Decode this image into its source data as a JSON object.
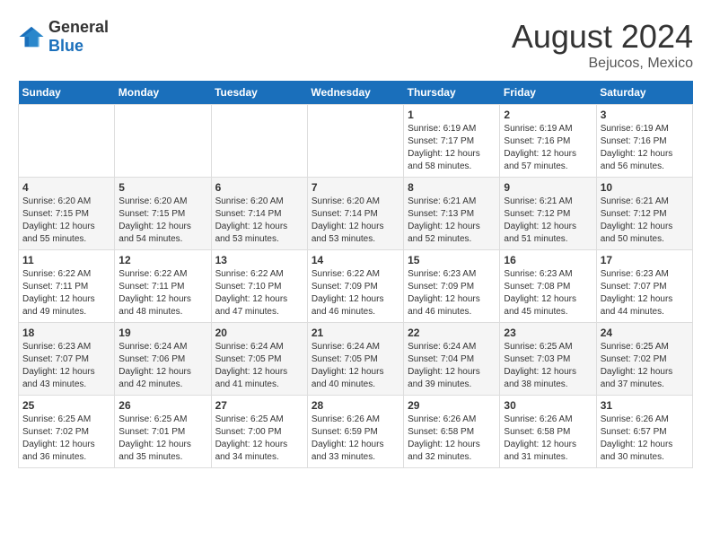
{
  "header": {
    "logo_general": "General",
    "logo_blue": "Blue",
    "month_year": "August 2024",
    "location": "Bejucos, Mexico"
  },
  "weekdays": [
    "Sunday",
    "Monday",
    "Tuesday",
    "Wednesday",
    "Thursday",
    "Friday",
    "Saturday"
  ],
  "weeks": [
    [
      {
        "day": "",
        "info": ""
      },
      {
        "day": "",
        "info": ""
      },
      {
        "day": "",
        "info": ""
      },
      {
        "day": "",
        "info": ""
      },
      {
        "day": "1",
        "info": "Sunrise: 6:19 AM\nSunset: 7:17 PM\nDaylight: 12 hours\nand 58 minutes."
      },
      {
        "day": "2",
        "info": "Sunrise: 6:19 AM\nSunset: 7:16 PM\nDaylight: 12 hours\nand 57 minutes."
      },
      {
        "day": "3",
        "info": "Sunrise: 6:19 AM\nSunset: 7:16 PM\nDaylight: 12 hours\nand 56 minutes."
      }
    ],
    [
      {
        "day": "4",
        "info": "Sunrise: 6:20 AM\nSunset: 7:15 PM\nDaylight: 12 hours\nand 55 minutes."
      },
      {
        "day": "5",
        "info": "Sunrise: 6:20 AM\nSunset: 7:15 PM\nDaylight: 12 hours\nand 54 minutes."
      },
      {
        "day": "6",
        "info": "Sunrise: 6:20 AM\nSunset: 7:14 PM\nDaylight: 12 hours\nand 53 minutes."
      },
      {
        "day": "7",
        "info": "Sunrise: 6:20 AM\nSunset: 7:14 PM\nDaylight: 12 hours\nand 53 minutes."
      },
      {
        "day": "8",
        "info": "Sunrise: 6:21 AM\nSunset: 7:13 PM\nDaylight: 12 hours\nand 52 minutes."
      },
      {
        "day": "9",
        "info": "Sunrise: 6:21 AM\nSunset: 7:12 PM\nDaylight: 12 hours\nand 51 minutes."
      },
      {
        "day": "10",
        "info": "Sunrise: 6:21 AM\nSunset: 7:12 PM\nDaylight: 12 hours\nand 50 minutes."
      }
    ],
    [
      {
        "day": "11",
        "info": "Sunrise: 6:22 AM\nSunset: 7:11 PM\nDaylight: 12 hours\nand 49 minutes."
      },
      {
        "day": "12",
        "info": "Sunrise: 6:22 AM\nSunset: 7:11 PM\nDaylight: 12 hours\nand 48 minutes."
      },
      {
        "day": "13",
        "info": "Sunrise: 6:22 AM\nSunset: 7:10 PM\nDaylight: 12 hours\nand 47 minutes."
      },
      {
        "day": "14",
        "info": "Sunrise: 6:22 AM\nSunset: 7:09 PM\nDaylight: 12 hours\nand 46 minutes."
      },
      {
        "day": "15",
        "info": "Sunrise: 6:23 AM\nSunset: 7:09 PM\nDaylight: 12 hours\nand 46 minutes."
      },
      {
        "day": "16",
        "info": "Sunrise: 6:23 AM\nSunset: 7:08 PM\nDaylight: 12 hours\nand 45 minutes."
      },
      {
        "day": "17",
        "info": "Sunrise: 6:23 AM\nSunset: 7:07 PM\nDaylight: 12 hours\nand 44 minutes."
      }
    ],
    [
      {
        "day": "18",
        "info": "Sunrise: 6:23 AM\nSunset: 7:07 PM\nDaylight: 12 hours\nand 43 minutes."
      },
      {
        "day": "19",
        "info": "Sunrise: 6:24 AM\nSunset: 7:06 PM\nDaylight: 12 hours\nand 42 minutes."
      },
      {
        "day": "20",
        "info": "Sunrise: 6:24 AM\nSunset: 7:05 PM\nDaylight: 12 hours\nand 41 minutes."
      },
      {
        "day": "21",
        "info": "Sunrise: 6:24 AM\nSunset: 7:05 PM\nDaylight: 12 hours\nand 40 minutes."
      },
      {
        "day": "22",
        "info": "Sunrise: 6:24 AM\nSunset: 7:04 PM\nDaylight: 12 hours\nand 39 minutes."
      },
      {
        "day": "23",
        "info": "Sunrise: 6:25 AM\nSunset: 7:03 PM\nDaylight: 12 hours\nand 38 minutes."
      },
      {
        "day": "24",
        "info": "Sunrise: 6:25 AM\nSunset: 7:02 PM\nDaylight: 12 hours\nand 37 minutes."
      }
    ],
    [
      {
        "day": "25",
        "info": "Sunrise: 6:25 AM\nSunset: 7:02 PM\nDaylight: 12 hours\nand 36 minutes."
      },
      {
        "day": "26",
        "info": "Sunrise: 6:25 AM\nSunset: 7:01 PM\nDaylight: 12 hours\nand 35 minutes."
      },
      {
        "day": "27",
        "info": "Sunrise: 6:25 AM\nSunset: 7:00 PM\nDaylight: 12 hours\nand 34 minutes."
      },
      {
        "day": "28",
        "info": "Sunrise: 6:26 AM\nSunset: 6:59 PM\nDaylight: 12 hours\nand 33 minutes."
      },
      {
        "day": "29",
        "info": "Sunrise: 6:26 AM\nSunset: 6:58 PM\nDaylight: 12 hours\nand 32 minutes."
      },
      {
        "day": "30",
        "info": "Sunrise: 6:26 AM\nSunset: 6:58 PM\nDaylight: 12 hours\nand 31 minutes."
      },
      {
        "day": "31",
        "info": "Sunrise: 6:26 AM\nSunset: 6:57 PM\nDaylight: 12 hours\nand 30 minutes."
      }
    ]
  ]
}
